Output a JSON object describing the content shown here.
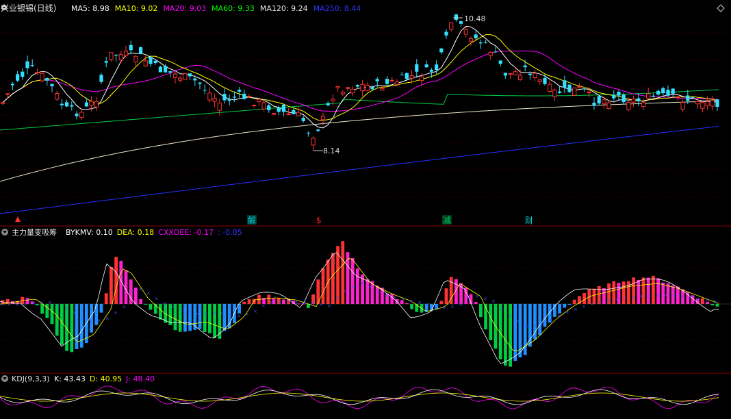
{
  "main_panel": {
    "stock_title": "兴业银锡(日线)",
    "ma": [
      {
        "label": "MA5: 8.98",
        "color": "#ffffff"
      },
      {
        "label": "MA10: 9.02",
        "color": "#ffff00"
      },
      {
        "label": "MA20: 9.03",
        "color": "#ff00ff"
      },
      {
        "label": "MA60: 9.33",
        "color": "#00ff00"
      },
      {
        "label": "MA120: 9.24",
        "color": "#e8e8e8"
      },
      {
        "label": "MA250: 8.44",
        "color": "#3333ff"
      }
    ],
    "high_label": "10.48",
    "low_label": "8.14",
    "markers": [
      {
        "text": "解",
        "color": "#00cccc"
      },
      {
        "text": "$",
        "color": "#ff2222"
      },
      {
        "text": "减",
        "color": "#00cc66"
      },
      {
        "text": "财",
        "color": "#00cccc"
      }
    ]
  },
  "macd_panel": {
    "title": "主力量变吸筹",
    "items": [
      {
        "label": "BYKMV: 0.10",
        "color": "#ffffff"
      },
      {
        "label": "DEA: 0.18",
        "color": "#ffff00"
      },
      {
        "label": "CXXDEE: -0.17",
        "color": "#ff00ff"
      },
      {
        "label": ": -0.05",
        "color": "#3333ff"
      }
    ]
  },
  "kdj_panel": {
    "title": "KDJ(9,3,3)",
    "items": [
      {
        "label": "K: 43.43",
        "color": "#ffffff"
      },
      {
        "label": "D: 40.95",
        "color": "#ffff00"
      },
      {
        "label": "J: 48.40",
        "color": "#ff00ff"
      }
    ]
  },
  "colors": {
    "up": "#ff3333",
    "down": "#33e0ff",
    "grid": "#7a0000",
    "border": "#8b0000"
  }
}
